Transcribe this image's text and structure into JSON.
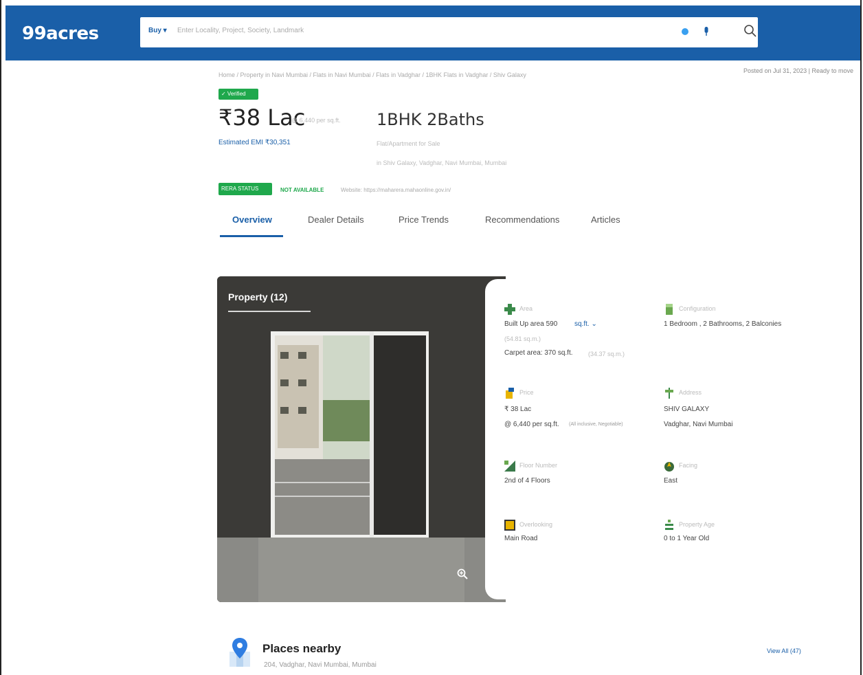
{
  "header": {
    "logo": "99acres",
    "buy_label": "Buy ▾",
    "search_placeholder": "Enter Locality, Project, Society, Landmark"
  },
  "breadcrumb": "Home  /  Property in Navi Mumbai  /  Flats in Navi Mumbai  /  Flats in Vadghar  /  1BHK Flats in Vadghar  /  Shiv Galaxy",
  "posted": "Posted on Jul 31, 2023  |  Ready to move",
  "listing": {
    "verified": "✓ Verified",
    "price": "₹38 Lac",
    "price_sub": "@ 6,440 per sq.ft.",
    "emi": "Estimated EMI ₹30,351",
    "bhk": "1BHK 2Baths",
    "type": "Flat/Apartment for Sale",
    "address": "in Shiv Galaxy, Vadghar, Navi Mumbai, Mumbai",
    "rera_badge": "RERA STATUS",
    "rera_na": "NOT AVAILABLE",
    "rera_url": "Website: https://maharera.mahaonline.gov.in/"
  },
  "tabs": [
    "Overview",
    "Dealer Details",
    "Price Trends",
    "Recommendations",
    "Articles"
  ],
  "gallery": {
    "title": "Property (12)"
  },
  "details": {
    "area_label": "Area",
    "area_value": "Built Up area  590",
    "area_unit": "sq.ft. ⌄",
    "area_sub": "(54.81 sq.m.)",
    "carpet": "Carpet area: 370 sq.ft.",
    "carpet_sub": "(34.37 sq.m.)",
    "config_label": "Configuration",
    "config_value": "1 Bedroom , 2 Bathrooms, 2 Balconies",
    "price_label": "Price",
    "price_value": "₹ 38 Lac",
    "price_rate": "@ 6,440 per sq.ft.",
    "price_note": "(All inclusive, Negotiable)",
    "addr_label": "Address",
    "addr_name": "SHIV GALAXY",
    "addr_loc": "Vadghar, Navi Mumbai",
    "floor_label": "Floor Number",
    "floor_value": "2nd  of 4 Floors",
    "facing_label": "Facing",
    "facing_value": "East",
    "overlook_label": "Overlooking",
    "overlook_value": "Main Road",
    "age_label": "Property Age",
    "age_value": "0 to 1 Year Old"
  },
  "places": {
    "title": "Places nearby",
    "subtitle": "204, Vadghar, Navi Mumbai, Mumbai",
    "view_all": "View All (47)"
  }
}
